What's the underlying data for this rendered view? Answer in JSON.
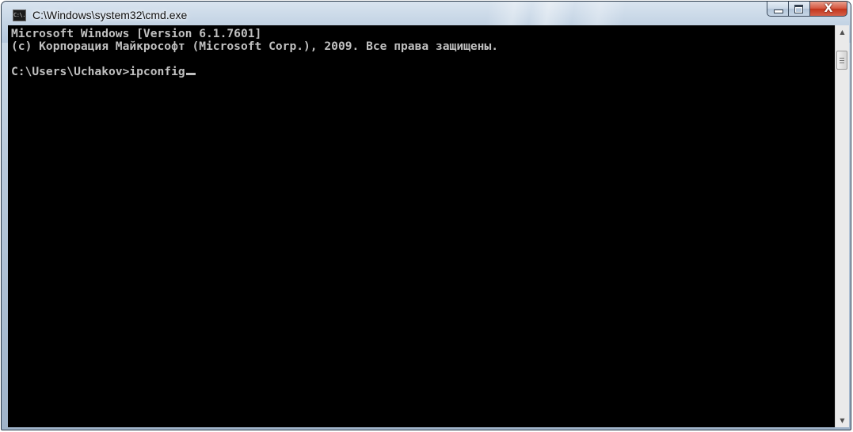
{
  "window": {
    "title": "C:\\Windows\\system32\\cmd.exe",
    "icon": "cmd-app-icon",
    "icon_label": "C:\\."
  },
  "caption_buttons": {
    "minimize_icon": "minimize-icon",
    "maximize_icon": "maximize-icon",
    "close_label": "X"
  },
  "console": {
    "lines": [
      "Microsoft Windows [Version 6.1.7601]",
      "(c) Корпорация Майкрософт (Microsoft Corp.), 2009. Все права защищены.",
      "",
      "C:\\Users\\Uchakov>ipconfig"
    ],
    "background": "#000000",
    "foreground": "#c0c0c0"
  },
  "scrollbar": {
    "up_arrow": "▲",
    "down_arrow": "▼"
  }
}
